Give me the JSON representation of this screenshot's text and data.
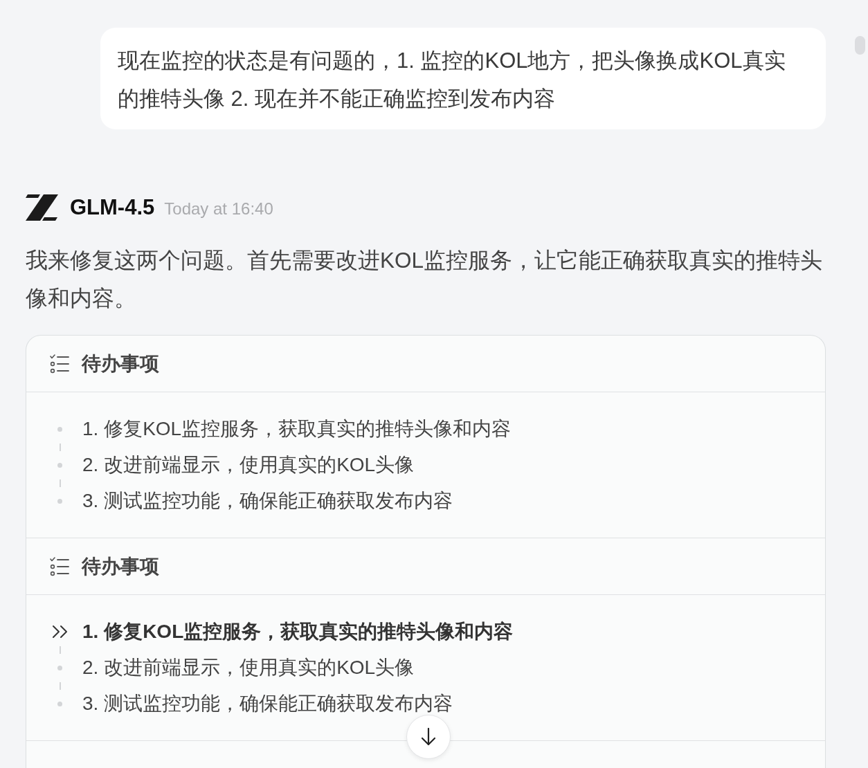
{
  "user_message": {
    "text": "现在监控的状态是有问题的，1. 监控的KOL地方，把头像换成KOL真实的推特头像 2. 现在并不能正确监控到发布内容"
  },
  "assistant": {
    "model_name": "GLM-4.5",
    "timestamp": "Today at 16:40",
    "text": "我来修复这两个问题。首先需要改进KOL监控服务，让它能正确获取真实的推特头像和内容。"
  },
  "todo_panels": [
    {
      "title": "待办事项",
      "items": [
        {
          "text": "1. 修复KOL监控服务，获取真实的推特头像和内容",
          "active": false
        },
        {
          "text": "2. 改进前端显示，使用真实的KOL头像",
          "active": false
        },
        {
          "text": "3. 测试监控功能，确保能正确获取发布内容",
          "active": false
        }
      ]
    },
    {
      "title": "待办事项",
      "items": [
        {
          "text": "1. 修复KOL监控服务，获取真实的推特头像和内容",
          "active": true
        },
        {
          "text": "2. 改进前端显示，使用真实的KOL头像",
          "active": false
        },
        {
          "text": "3. 测试监控功能，确保能正确获取发布内容",
          "active": false
        }
      ]
    }
  ]
}
